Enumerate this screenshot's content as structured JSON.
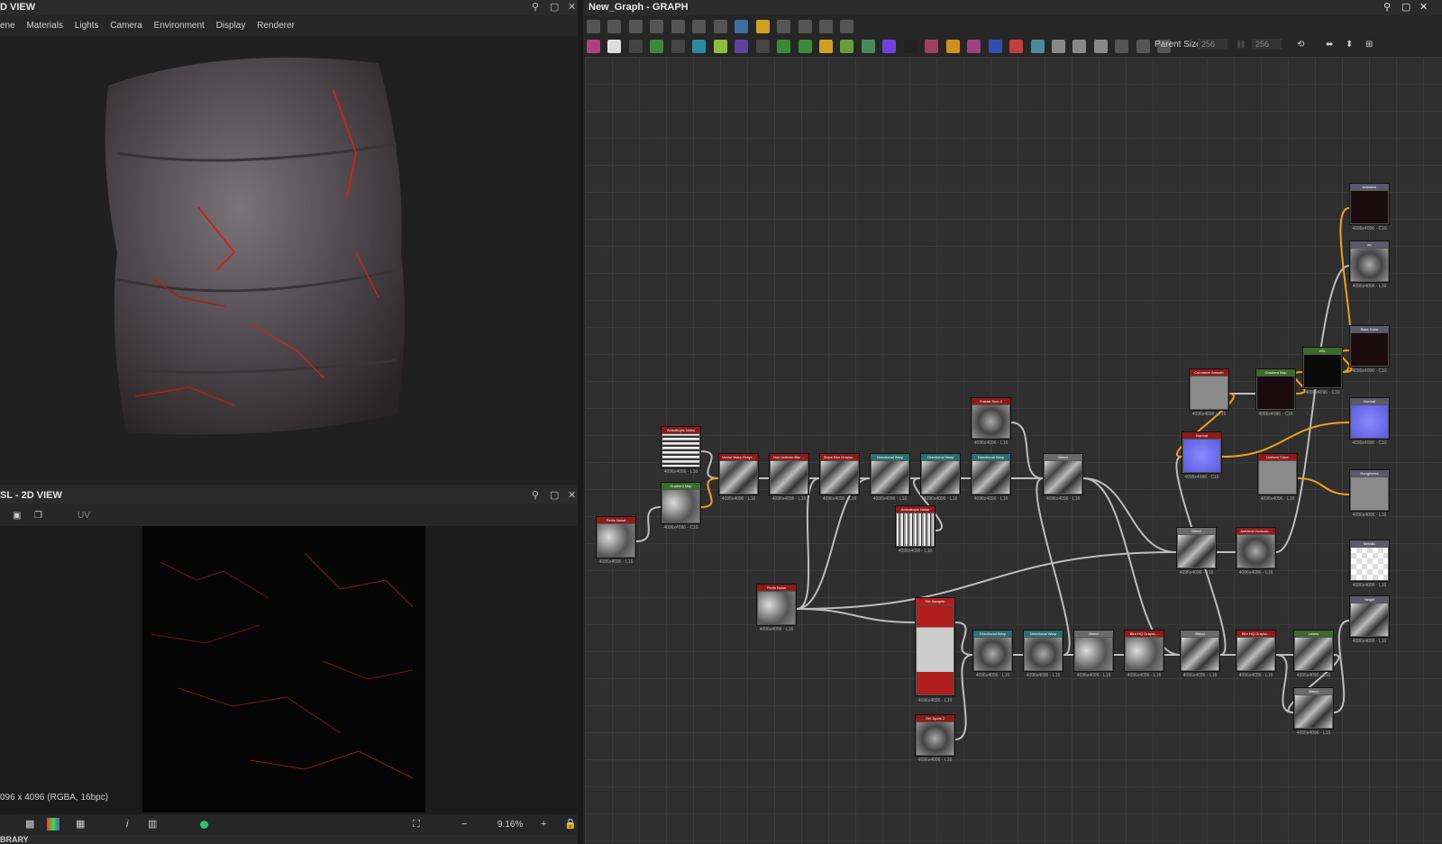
{
  "view3d": {
    "title": "D VIEW",
    "menu": [
      "ene",
      "Materials",
      "Lights",
      "Camera",
      "Environment",
      "Display",
      "Renderer"
    ]
  },
  "view2d": {
    "title": "SL - 2D VIEW",
    "uv_label": "UV",
    "status": "096 x 4096 (RGBA, 16bpc)",
    "zoom": "9.16%"
  },
  "library": {
    "title": "BRARY"
  },
  "graph": {
    "title": "New_Graph - GRAPH",
    "parent_size_label": "Parent Size:",
    "parent_size_value": "256",
    "parent_size_value2": "256"
  },
  "nodes": [
    {
      "id": "perlin1",
      "title": "Perlin Noise",
      "color": "#8b1c1c",
      "size": "4096x4096 · L16",
      "tex": "cloud"
    },
    {
      "id": "aniso1",
      "title": "Anisotropic Noise",
      "color": "#8b1c1c",
      "size": "4096x4096 · L16",
      "tex": "streak"
    },
    {
      "id": "gradmap1",
      "title": "Gradient Map",
      "color": "#3b6b2a",
      "size": "4096x4096 · C16",
      "tex": "cloud"
    },
    {
      "id": "vwarp",
      "title": "Vector Warp Grays...",
      "color": "#8b1c1c",
      "size": "4096x4096 · L16",
      "tex": "marble"
    },
    {
      "id": "nonuni",
      "title": "Non Uniform Blur ...",
      "color": "#8b1c1c",
      "size": "4096x4096 · L16",
      "tex": "marble"
    },
    {
      "id": "slope",
      "title": "Slope Blur Graysc...",
      "color": "#8b1c1c",
      "size": "4096x4096 · L16",
      "tex": "marble"
    },
    {
      "id": "dw1",
      "title": "Directional Warp",
      "color": "#2d6e6e",
      "size": "4096x4096 · L16",
      "tex": "marble"
    },
    {
      "id": "dw2",
      "title": "Directional Warp",
      "color": "#2d6e6e",
      "size": "4096x4096 · L16",
      "tex": "marble"
    },
    {
      "id": "dw3",
      "title": "Directional Warp",
      "color": "#2d6e6e",
      "size": "4096x4096 · L16",
      "tex": "marble"
    },
    {
      "id": "fractal",
      "title": "Fractal Sum 2",
      "color": "#8b1c1c",
      "size": "4096x4096 · L16",
      "tex": "noise"
    },
    {
      "id": "blend1",
      "title": "Blend",
      "color": "#6a6a6a",
      "size": "4096x4096 · L16",
      "tex": "marble"
    },
    {
      "id": "aniso2",
      "title": "Anisotropic Noise",
      "color": "#8b1c1c",
      "size": "4096x4096 · L16",
      "tex": "stripes"
    },
    {
      "id": "perlin2",
      "title": "Perlin Noise",
      "color": "#8b1c1c",
      "size": "4096x4096 · L16",
      "tex": "cloud"
    },
    {
      "id": "tile",
      "title": "Tile Sampler",
      "color": "#b11e1e",
      "size": "4096x4096 · L16",
      "tex": "tile"
    },
    {
      "id": "grit",
      "title": "Grit Spots 2",
      "color": "#8b1c1c",
      "size": "4096x4096 · L16",
      "tex": "noise"
    },
    {
      "id": "dw4",
      "title": "Directional Warp",
      "color": "#2d6e6e",
      "size": "4096x4096 · L16",
      "tex": "noise"
    },
    {
      "id": "dw5",
      "title": "Directional Warp",
      "color": "#2d6e6e",
      "size": "4096x4096 · L16",
      "tex": "noise"
    },
    {
      "id": "blend2",
      "title": "Blend",
      "color": "#6a6a6a",
      "size": "4096x4096 · L16",
      "tex": "cloud"
    },
    {
      "id": "blurhq1",
      "title": "Blur HQ Graysc...",
      "color": "#8b1c1c",
      "size": "4096x4096 · L16",
      "tex": "cloud"
    },
    {
      "id": "blend3",
      "title": "Blend",
      "color": "#6a6a6a",
      "size": "4096x4096 · L16",
      "tex": "marble"
    },
    {
      "id": "blurhq2",
      "title": "Blur HQ Graysc...",
      "color": "#8b1c1c",
      "size": "4096x4096 · L16",
      "tex": "marble"
    },
    {
      "id": "levels",
      "title": "Levels",
      "color": "#3b6b2a",
      "size": "4096x4096 · L16",
      "tex": "marble"
    },
    {
      "id": "blend4",
      "title": "Blend",
      "color": "#6a6a6a",
      "size": "4096x4096 · L16",
      "tex": "marble"
    },
    {
      "id": "blend5",
      "title": "Blend",
      "color": "#6a6a6a",
      "size": "4096x4096 · L16",
      "tex": "marble"
    },
    {
      "id": "ao",
      "title": "Ambient Occlusio...",
      "color": "#8b1c1c",
      "size": "4096x4096 · L16",
      "tex": "noise"
    },
    {
      "id": "normal",
      "title": "Normal",
      "color": "#8b1c1c",
      "size": "4096x4096 · C16",
      "tex": "normal"
    },
    {
      "id": "curv",
      "title": "Curvature Smooth",
      "color": "#8b1c1c",
      "size": "4096x4096 · L16",
      "tex": "flat"
    },
    {
      "id": "gradmap2",
      "title": "Gradient Map",
      "color": "#3b6b2a",
      "size": "4096x4096 · C16",
      "tex": "dark"
    },
    {
      "id": "uniform",
      "title": "Uniform Color",
      "color": "#8b1c1c",
      "size": "4096x4096 · L16",
      "tex": "flat"
    },
    {
      "id": "hsl",
      "title": "HSL",
      "color": "#3b6b2a",
      "size": "4096x4096 · C16",
      "tex": "black"
    },
    {
      "id": "out_emissive",
      "title": "emissive",
      "color": "#5a5a6a",
      "size": "4096x4096 · C16",
      "tex": "dark"
    },
    {
      "id": "out_ao",
      "title": "ao",
      "color": "#5a5a6a",
      "size": "4096x4096 · L16",
      "tex": "noise"
    },
    {
      "id": "out_base",
      "title": "Base Color",
      "color": "#5a5a6a",
      "size": "4096x4096 · C16",
      "tex": "dark"
    },
    {
      "id": "out_normal",
      "title": "Normal",
      "color": "#5a5a6a",
      "size": "4096x4096 · C16",
      "tex": "normal"
    },
    {
      "id": "out_rough",
      "title": "Roughness",
      "color": "#5a5a6a",
      "size": "4096x4096 · L16",
      "tex": "flat"
    },
    {
      "id": "out_metal",
      "title": "Metallic",
      "color": "#5a5a6a",
      "size": "4096x4096 · L16",
      "tex": "checker"
    },
    {
      "id": "out_height",
      "title": "Height",
      "color": "#5a5a6a",
      "size": "4096x4096 · L16",
      "tex": "marble"
    }
  ],
  "colors": {
    "accent_wire": "#f0a020",
    "wire": "#bdbdbd",
    "node_red": "#8b1c1c"
  }
}
